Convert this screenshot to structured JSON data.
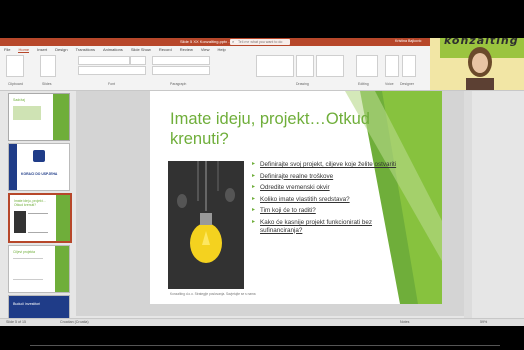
{
  "app": {
    "window_title": "Slide 5 XX Konzalting.pptx - PowerPoint",
    "search_placeholder": "Tell me what you want to do",
    "user_name": "Kristina Bajkovic",
    "accent": "#b7472a"
  },
  "ribbon": {
    "tabs": [
      "File",
      "Home",
      "Insert",
      "Design",
      "Transitions",
      "Animations",
      "Slide Show",
      "Record",
      "Review",
      "View",
      "Help"
    ],
    "active_tab": "Home",
    "groups": [
      "Clipboard",
      "Slides",
      "Font",
      "Paragraph",
      "Drawing",
      "Editing",
      "Voice",
      "Designer"
    ]
  },
  "thumbnails": [
    {
      "num": "1",
      "title": "Sadržaj"
    },
    {
      "num": "2",
      "title": "KORACI DO USPJEHA"
    },
    {
      "num": "3",
      "title": "Imate ideju, projekt…Otkud krenuti?"
    },
    {
      "num": "4",
      "title": "Ciljevi projekta"
    },
    {
      "num": "5",
      "title": "Budući investitori"
    }
  ],
  "slide": {
    "title": "Imate ideju, projekt…Otkud krenuti?",
    "bullets": [
      "Definirajte svoj projekt, ciljeve koje želite ostvariti",
      "Definirajte realne troškove",
      "Odredite vremenski okvir",
      "Koliko imate vlastitih sredstava?",
      "Tim koji će to raditi?",
      "Kako će kasnije projekt funkcionirati bez sufinanciranja?"
    ],
    "footer": "Konzalting d.o.o. Strategije poslovanja. Savjetujte se s nama"
  },
  "statusbar": {
    "left": "Slide 5 of 15",
    "lang": "Croatian (Croatia)",
    "notes": "Notes",
    "zoom": "59%"
  },
  "webcam": {
    "brand_text": "konzalting"
  }
}
